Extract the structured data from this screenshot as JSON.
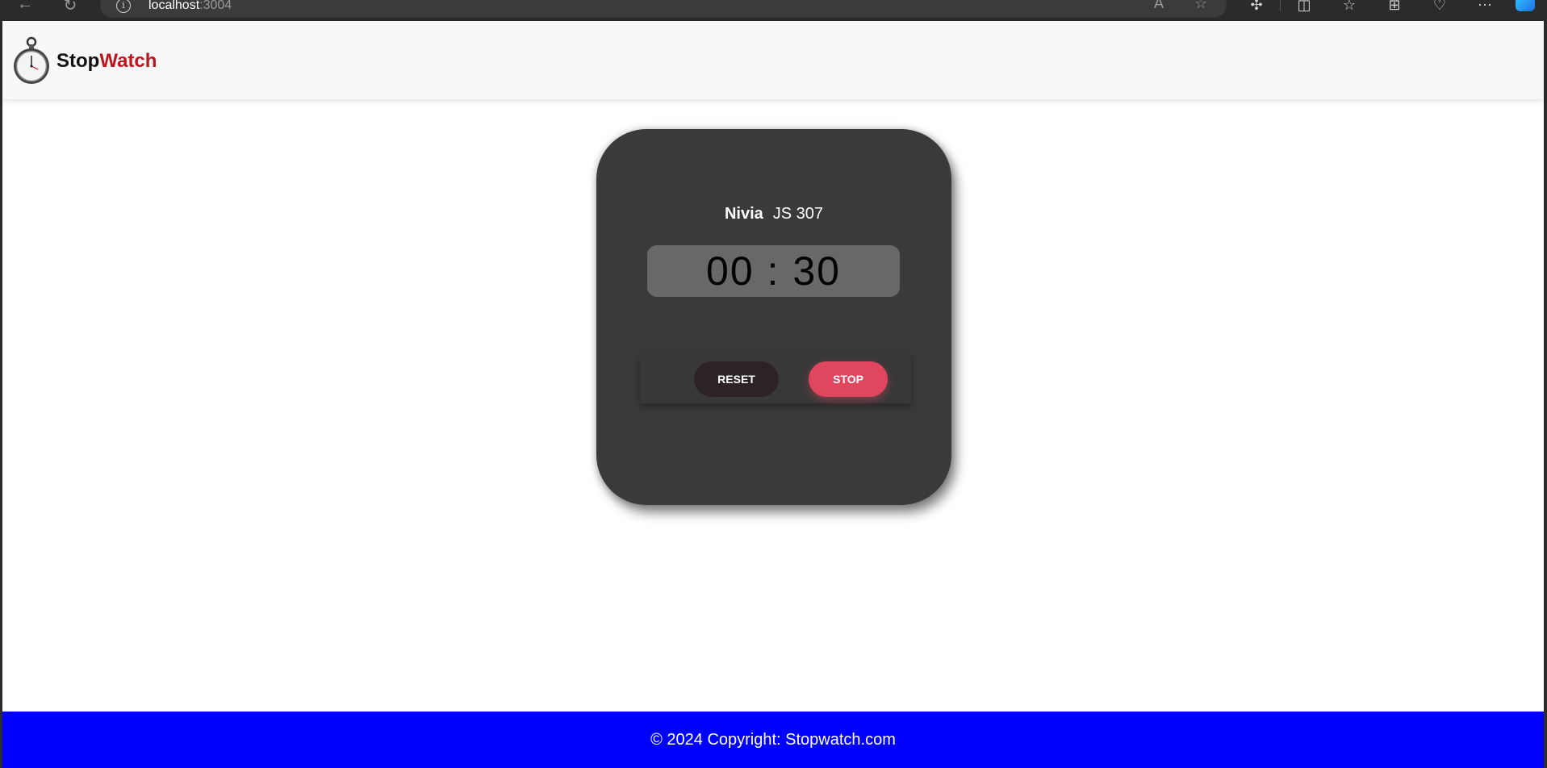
{
  "browser": {
    "url_host": "localhost",
    "url_port": ":3004",
    "info_glyph": "i"
  },
  "navbar": {
    "brand_part1": "Stop",
    "brand_part2": "Watch",
    "brand_colors": {
      "part1": "#111111",
      "part2": "#c0141c"
    }
  },
  "stopwatch": {
    "brand": "Nivia",
    "model": "JS 307",
    "time": "00 : 30",
    "reset_label": "RESET",
    "stop_label": "STOP",
    "colors": {
      "body": "#3a3a3a",
      "display": "#686868",
      "stop_button": "#e0475f",
      "reset_button": "#2c2424"
    }
  },
  "footer": {
    "text": "© 2024 Copyright: Stopwatch.com",
    "background": "#0000ff"
  },
  "icons": [
    "back-arrow-icon",
    "refresh-icon",
    "info-icon",
    "read-aloud-icon",
    "favorite-star-icon",
    "extensions-icon",
    "split-screen-icon",
    "favorites-icon",
    "collections-icon",
    "browser-essentials-icon",
    "more-icon",
    "copilot-icon",
    "stopwatch-logo-icon"
  ]
}
